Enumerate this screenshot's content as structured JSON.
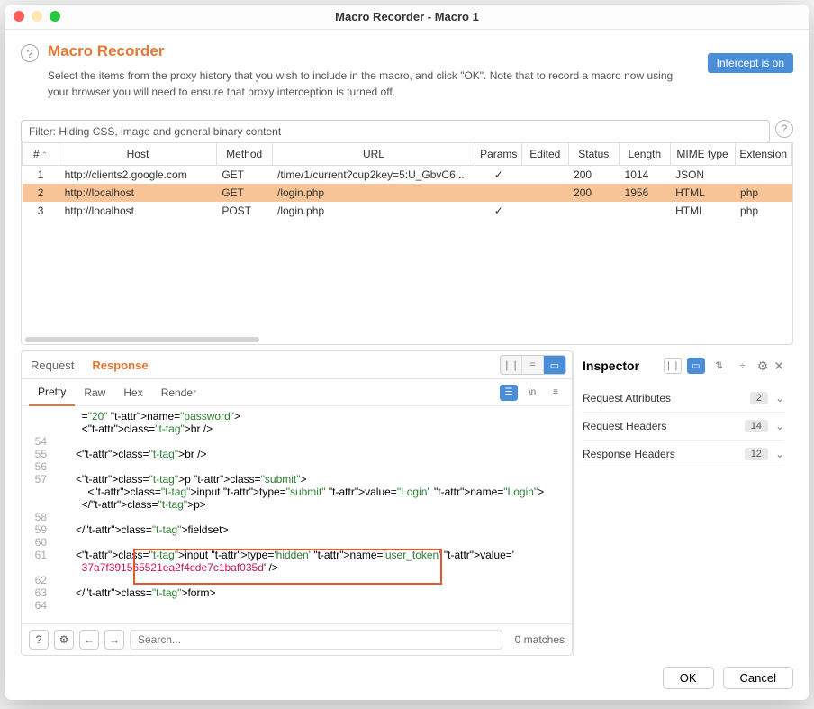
{
  "window_title": "Macro Recorder - Macro 1",
  "header": {
    "title": "Macro Recorder",
    "desc": "Select the items from the proxy history that you wish to include in the macro, and click \"OK\". Note that to record a macro now using your browser you will need to ensure that proxy interception is turned off.",
    "intercept_btn": "Intercept is on"
  },
  "filter_text": "Filter: Hiding CSS, image and general binary content",
  "columns": {
    "num": "#",
    "host": "Host",
    "method": "Method",
    "url": "URL",
    "params": "Params",
    "edited": "Edited",
    "status": "Status",
    "length": "Length",
    "mime": "MIME type",
    "ext": "Extension"
  },
  "rows": [
    {
      "num": "1",
      "host": "http://clients2.google.com",
      "method": "GET",
      "url": "/time/1/current?cup2key=5:U_GbvC6...",
      "params": "✓",
      "edited": "",
      "status": "200",
      "length": "1014",
      "mime": "JSON",
      "ext": ""
    },
    {
      "num": "2",
      "host": "http://localhost",
      "method": "GET",
      "url": "/login.php",
      "params": "",
      "edited": "",
      "status": "200",
      "length": "1956",
      "mime": "HTML",
      "ext": "php"
    },
    {
      "num": "3",
      "host": "http://localhost",
      "method": "POST",
      "url": "/login.php",
      "params": "✓",
      "edited": "",
      "status": "",
      "length": "",
      "mime": "HTML",
      "ext": "php"
    }
  ],
  "tabs": {
    "request": "Request",
    "response": "Response"
  },
  "subtabs": {
    "pretty": "Pretty",
    "raw": "Raw",
    "hex": "Hex",
    "render": "Render"
  },
  "code_lines": [
    {
      "n": "",
      "html": "=\"20\" name=\"password\">"
    },
    {
      "n": "",
      "html": "<br />"
    },
    {
      "n": "54",
      "html": ""
    },
    {
      "n": "55",
      "html": "<br />"
    },
    {
      "n": "56",
      "html": ""
    },
    {
      "n": "57",
      "html": "<p class=\"submit\">"
    },
    {
      "n": "",
      "html": "  <input type=\"submit\" value=\"Login\" name=\"Login\">"
    },
    {
      "n": "",
      "html": "</p>"
    },
    {
      "n": "58",
      "html": ""
    },
    {
      "n": "59",
      "html": "</fieldset>"
    },
    {
      "n": "60",
      "html": ""
    },
    {
      "n": "61",
      "html": "<input type='hidden' name='user_token' value='"
    },
    {
      "n": "",
      "html": "37a7f391565521ea2f4cde7c1baf035d' />"
    },
    {
      "n": "62",
      "html": ""
    },
    {
      "n": "63",
      "html": "</form>"
    },
    {
      "n": "64",
      "html": ""
    }
  ],
  "search": {
    "placeholder": "Search...",
    "matches": "0 matches"
  },
  "inspector": {
    "title": "Inspector",
    "rows": [
      {
        "label": "Request Attributes",
        "count": "2"
      },
      {
        "label": "Request Headers",
        "count": "14"
      },
      {
        "label": "Response Headers",
        "count": "12"
      }
    ]
  },
  "buttons": {
    "ok": "OK",
    "cancel": "Cancel"
  }
}
